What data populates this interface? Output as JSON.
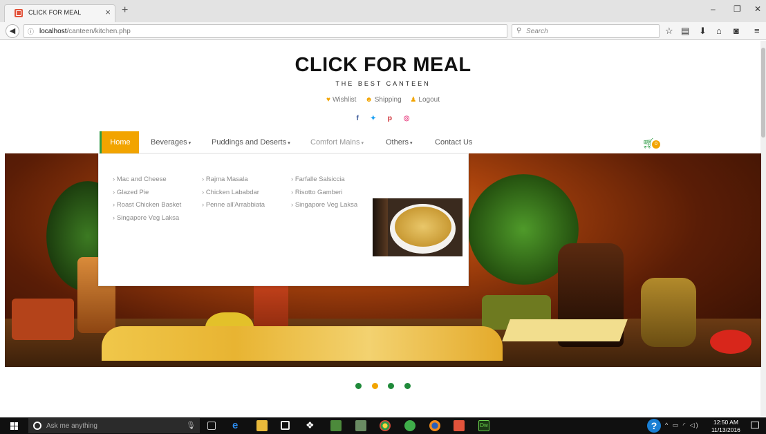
{
  "browser": {
    "tab_title": "CLICK FOR MEAL",
    "tab_close": "×",
    "new_tab": "+",
    "url_host": "localhost",
    "url_path": "/canteen/kitchen.php",
    "search_placeholder": "Search",
    "window_controls": [
      "–",
      "❐",
      "✕"
    ]
  },
  "header": {
    "title": "CLICK FOR MEAL",
    "subtitle": "THE BEST CANTEEN",
    "user_links": [
      {
        "label": "Wishlist",
        "icon": "heart-icon"
      },
      {
        "label": "Shipping",
        "icon": "user-icon"
      },
      {
        "label": "Logout",
        "icon": "person-icon"
      }
    ],
    "social": [
      {
        "glyph": "f",
        "icon": "facebook-icon",
        "color": "#3b5998"
      },
      {
        "glyph": "🐦",
        "icon": "twitter-icon",
        "color": "#1da1f2"
      },
      {
        "glyph": "p",
        "icon": "pinterest-icon",
        "color": "#cb2027"
      },
      {
        "glyph": "◎",
        "icon": "dribbble-icon",
        "color": "#ea4c89"
      }
    ]
  },
  "menu": {
    "home": "Home",
    "items": [
      "Beverages",
      "Puddings and Deserts",
      "Comfort Mains",
      "Others"
    ],
    "contact": "Contact Us",
    "cart_count": "0"
  },
  "mega_menu": {
    "col1": [
      "Mac and Cheese",
      "Glazed Pie",
      "Roast Chicken Basket",
      "Singapore Veg Laksa"
    ],
    "col2": [
      "Rajma Masala",
      "Chicken Lababdar",
      "Penne all'Arrabbiata"
    ],
    "col3": [
      "Farfalle Salsiccia",
      "Risotto Gamberi",
      "Singapore Veg Laksa"
    ]
  },
  "carousel": {
    "slides": 4,
    "active_index": 1
  },
  "colors": {
    "accent": "#f2a400",
    "green": "#2e9b45"
  },
  "taskbar": {
    "search_placeholder": "Ask me anything",
    "time": "12:50 AM",
    "date": "11/13/2016",
    "dw_label": "Dw"
  }
}
